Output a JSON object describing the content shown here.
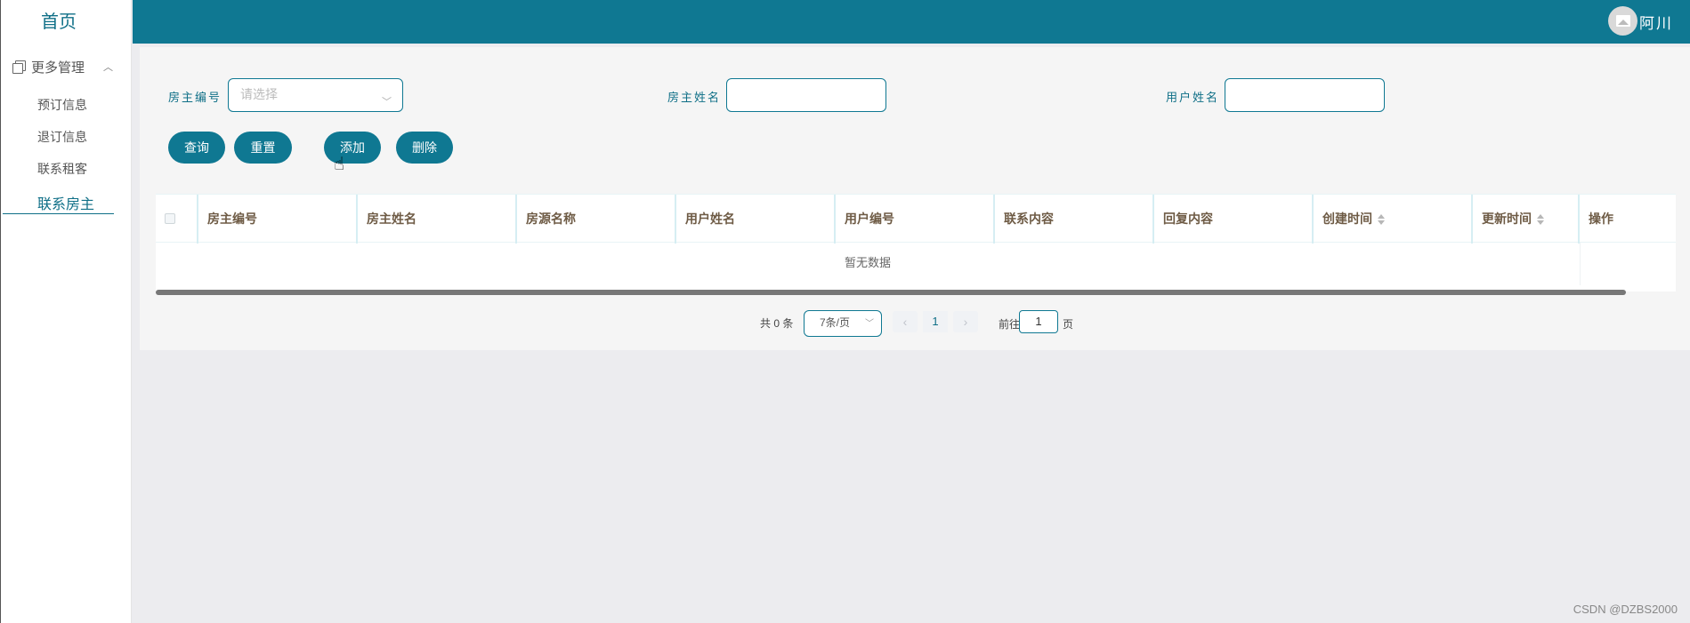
{
  "sidebar": {
    "home": "首页",
    "group_label": "更多管理",
    "items": [
      {
        "label": "预订信息"
      },
      {
        "label": "退订信息"
      },
      {
        "label": "联系租客"
      },
      {
        "label": "联系房主"
      }
    ],
    "active_index": 3
  },
  "header": {
    "username": "阿川"
  },
  "filters": {
    "owner_id_label": "房主编号",
    "owner_id_placeholder": "请选择",
    "owner_name_label": "房主姓名",
    "owner_name_value": "",
    "user_name_label": "用户姓名",
    "user_name_value": ""
  },
  "actions": {
    "query": "查询",
    "reset": "重置",
    "add": "添加",
    "delete": "删除"
  },
  "table": {
    "columns": [
      "房主编号",
      "房主姓名",
      "房源名称",
      "用户姓名",
      "用户编号",
      "联系内容",
      "回复内容",
      "创建时间",
      "更新时间",
      "操作"
    ],
    "empty_text": "暂无数据"
  },
  "pagination": {
    "total_text": "共 0 条",
    "page_size": "7条/页",
    "current_page": "1",
    "goto_prefix": "前往",
    "goto_value": "1",
    "goto_suffix": "页"
  },
  "watermark": "CSDN @DZBS2000",
  "colors": {
    "primary": "#0f7892",
    "header_bg": "#0f7892",
    "column_header_text": "#6e5b45"
  }
}
